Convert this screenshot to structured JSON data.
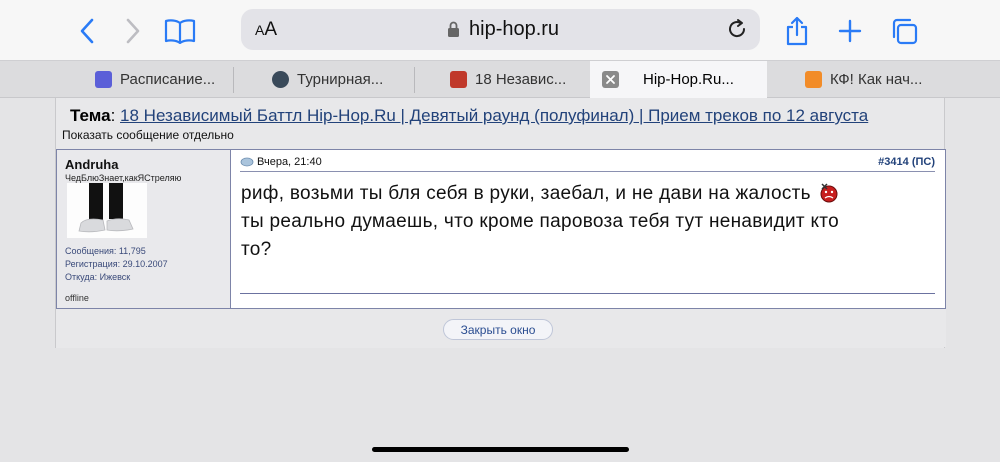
{
  "browser": {
    "text_size_label": "AA",
    "host": "hip-hop.ru",
    "icons": [
      "chevron-left-icon",
      "chevron-right-icon",
      "book-icon",
      "lock-icon",
      "reload-icon",
      "share-icon",
      "plus-icon",
      "tabs-icon"
    ]
  },
  "tabs": [
    {
      "label": "Расписание...",
      "favicon_color": "#5b5fd8"
    },
    {
      "label": "Турнирная...",
      "favicon_color": "#3a4a5a"
    },
    {
      "label": "18 Независ...",
      "favicon_color": "#c0392b"
    },
    {
      "label": "Hip-Hop.Ru...",
      "favicon_color": "#8a8a8a"
    },
    {
      "label": "КФ! Как нач...",
      "favicon_color": "#f28c28"
    }
  ],
  "thread": {
    "topic_label": "Тема",
    "topic_title": "18 Независимый Баттл Hip-Hop.Ru | Девятый раунд (полуфинал) | Прием треков по 12 августа",
    "show_single": "Показать сообщение отдельно"
  },
  "post": {
    "user": {
      "name": "Andruha",
      "title": "ЧедБлюЗнает,какЯСтреляю",
      "posts": "Сообщения: 11,795",
      "registered": "Регистрация: 29.10.2007",
      "location": "Откуда: Ижевск",
      "status": "offline"
    },
    "date": "Вчера, 21:40",
    "number": "#3414",
    "ps": "(ПС)",
    "line1": "риф, возьми ты бля себя в руки, заебал, и не дави на жалость",
    "line2": "ты реально думаешь, что кроме паровоза тебя тут ненавидит кто",
    "line3": "то?"
  },
  "footer": {
    "close_label": "Закрыть окно"
  },
  "colors": {
    "accent": "#2a7bf6",
    "link": "#22427a"
  }
}
